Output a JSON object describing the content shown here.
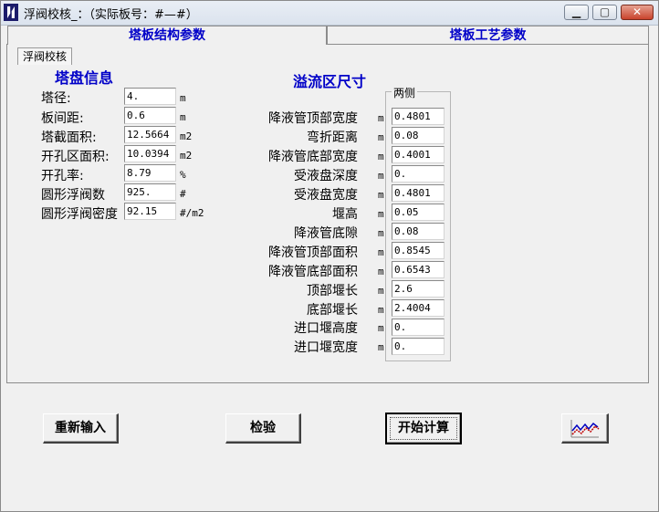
{
  "window": {
    "title": "浮阀校核_：（实际板号：#—#）"
  },
  "tabs": [
    {
      "label": "塔板结构参数"
    },
    {
      "label": "塔板工艺参数"
    }
  ],
  "subtab": {
    "label": "浮阀校核"
  },
  "tray_info": {
    "title": "塔盘信息",
    "rows": [
      {
        "label": "塔径:",
        "value": "4.",
        "unit": "m"
      },
      {
        "label": "板间距:",
        "value": "0.6",
        "unit": "m"
      },
      {
        "label": "塔截面积:",
        "value": "12.5664",
        "unit": "m2"
      },
      {
        "label": "开孔区面积:",
        "value": "10.0394",
        "unit": "m2"
      },
      {
        "label": "开孔率:",
        "value": "8.79",
        "unit": "%"
      },
      {
        "label": "圆形浮阀数",
        "value": "925.",
        "unit": "#"
      },
      {
        "label": "圆形浮阀密度",
        "value": "92.15",
        "unit": "#/m2"
      }
    ]
  },
  "overflow": {
    "title": "溢流区尺寸",
    "group_label": "两侧",
    "rows": [
      {
        "label": "降液管顶部宽度",
        "unit": "m",
        "value": "0.4801"
      },
      {
        "label": "弯折距离",
        "unit": "m",
        "value": "0.08"
      },
      {
        "label": "降液管底部宽度",
        "unit": "m",
        "value": "0.4001"
      },
      {
        "label": "受液盘深度",
        "unit": "m",
        "value": "0."
      },
      {
        "label": "受液盘宽度",
        "unit": "m",
        "value": "0.4801"
      },
      {
        "label": "堰高",
        "unit": "m",
        "value": "0.05"
      },
      {
        "label": "降液管底隙",
        "unit": "m",
        "value": "0.08"
      },
      {
        "label": "降液管顶部面积",
        "unit": "m",
        "value": "0.8545"
      },
      {
        "label": "降液管底部面积",
        "unit": "m",
        "value": "0.6543"
      },
      {
        "label": "顶部堰长",
        "unit": "m",
        "value": "2.6"
      },
      {
        "label": "底部堰长",
        "unit": "m",
        "value": "2.4004"
      },
      {
        "label": "进口堰高度",
        "unit": "m",
        "value": "0."
      },
      {
        "label": "进口堰宽度",
        "unit": "m",
        "value": "0."
      }
    ]
  },
  "buttons": {
    "reset": "重新输入",
    "check": "检验",
    "compute": "开始计算"
  },
  "icons": {
    "chart_button": "line-chart-icon",
    "close": "close-icon",
    "minimize": "minimize-icon",
    "maximize": "maximize-icon"
  }
}
